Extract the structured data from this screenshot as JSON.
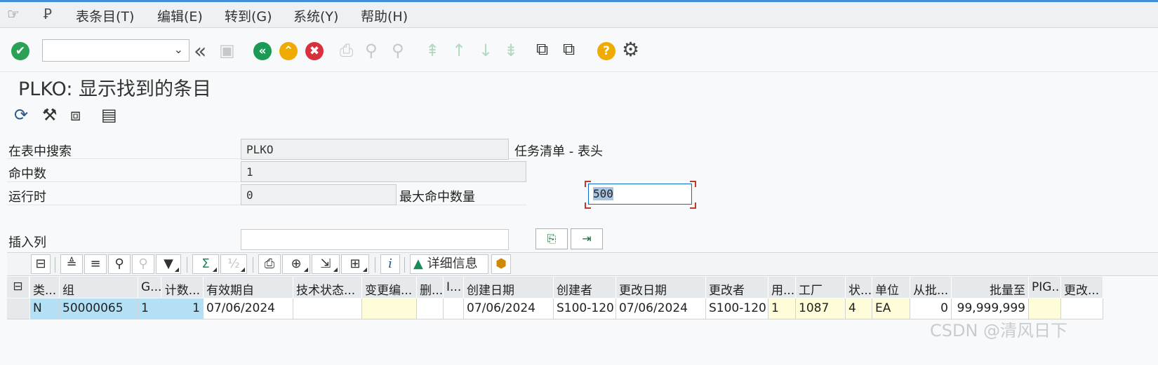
{
  "menubar": {
    "items": [
      "表条目(T)",
      "编辑(E)",
      "转到(G)",
      "系统(Y)",
      "帮助(H)"
    ]
  },
  "icons": {
    "menu_glyph": "☞",
    "sap_glyph": "Ꝑ",
    "enter": "✔",
    "back": "«",
    "chevron_back": "‹",
    "exit": "⌃",
    "cancel": "✖",
    "help": "?",
    "settings": "⚙"
  },
  "title": {
    "table": "PLKO",
    "text": "显示找到的条目"
  },
  "form": {
    "search_label": "在表中搜索",
    "search_value": "PLKO",
    "search_desc": "任务清单 - 表头",
    "hits_label": "命中数",
    "hits_value": "1",
    "runtime_label": "运行时",
    "runtime_value": "0",
    "max_hits_label": "最大命中数量",
    "max_hits_value": "500",
    "insert_col_label": "插入列",
    "insert_col_value": ""
  },
  "grid_toolbar": {
    "details_label": "详细信息",
    "sum_symbol": "Σ",
    "subtotal_symbol": "½",
    "info_symbol": "i"
  },
  "table": {
    "columns": [
      "类...",
      "组",
      "G...",
      "计数...",
      "有效期自",
      "技术状态...",
      "变更编...",
      "删...",
      "I...",
      "创建日期",
      "创建者",
      "更改日期",
      "更改者",
      "用...",
      "工厂",
      "状...",
      "单位",
      "从批...",
      "批量至",
      "PIG...",
      "更改..."
    ],
    "rows": [
      [
        "N",
        "50000065",
        "1",
        "1",
        "07/06/2024",
        "",
        "",
        "",
        "",
        "07/06/2024",
        "S100-120",
        "07/06/2024",
        "S100-120",
        "1",
        "1087",
        "4",
        "EA",
        "0",
        "99,999,999",
        "",
        ""
      ]
    ]
  },
  "watermark": "CSDN @清风日下"
}
